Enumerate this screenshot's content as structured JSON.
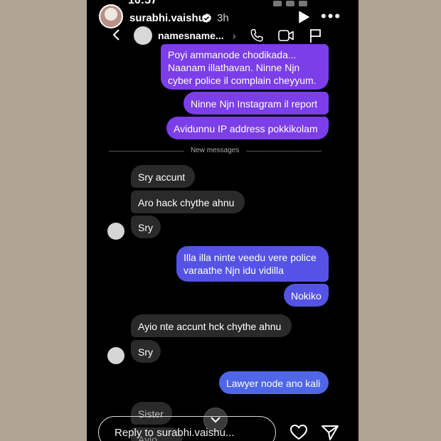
{
  "status": {
    "time": "10:57"
  },
  "story": {
    "username": "surabhi.vaishu",
    "time_ago": "3h"
  },
  "chat": {
    "name": "namesname...",
    "divider": "New messages"
  },
  "messages": [
    {
      "text": "Poyi ammanode chodikada...\nNaanam illathavan. Ninne Njn\ncyber police il complain cheyyum."
    },
    {
      "text": "Ninne Njn Instagram il report"
    },
    {
      "text": "Avidunnu IP address pokkikolam"
    },
    {
      "text": "Sry accunt"
    },
    {
      "text": "Aro hack chythe ahnu"
    },
    {
      "text": "Sry"
    },
    {
      "text": "Illa illa ninte veedu vere police\nvaraathe Njn idu vidilla"
    },
    {
      "text": "Nokiko"
    },
    {
      "text": "Ayio nte accunt hck chythe ahnu"
    },
    {
      "text": "Sry"
    },
    {
      "text": "Lawyer node ano kali"
    },
    {
      "text": "Sister"
    },
    {
      "text": "Ayio alla"
    }
  ],
  "reply": {
    "placeholder": "Reply to surabhi.vaishu..."
  },
  "colors": {
    "outgoing_purple": "#7b3ee8",
    "outgoing_blue": "#5553e6",
    "incoming": "#2a2a2a",
    "background": "#b0a594"
  }
}
